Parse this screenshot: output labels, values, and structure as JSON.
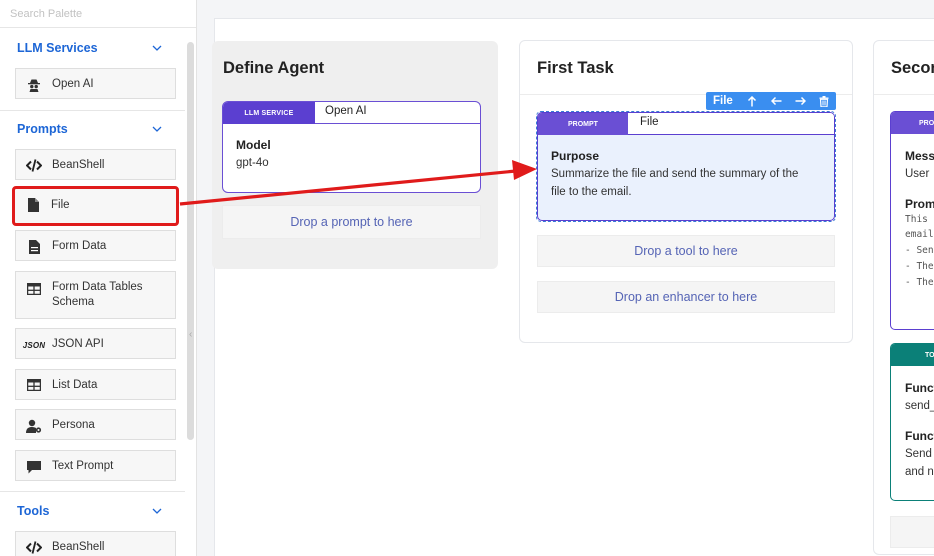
{
  "search": {
    "placeholder": "Search Palette"
  },
  "palette": {
    "llm_services": {
      "title": "LLM Services",
      "items": [
        {
          "label": "Open AI",
          "icon": "spy-icon"
        }
      ]
    },
    "prompts": {
      "title": "Prompts",
      "items": [
        {
          "label": "BeanShell",
          "icon": "code-icon"
        },
        {
          "label": "File",
          "icon": "file-icon"
        },
        {
          "label": "Form Data",
          "icon": "file-text-icon"
        },
        {
          "label": "Form Data Tables Schema",
          "icon": "table-icon"
        },
        {
          "label": "JSON API",
          "icon": "json-icon",
          "icon_text": "JSON"
        },
        {
          "label": "List Data",
          "icon": "table-icon"
        },
        {
          "label": "Persona",
          "icon": "user-gear-icon"
        },
        {
          "label": "Text Prompt",
          "icon": "speech-bubble-icon"
        }
      ]
    },
    "tools": {
      "title": "Tools",
      "items": [
        {
          "label": "BeanShell",
          "icon": "code-icon"
        }
      ]
    }
  },
  "define_agent": {
    "title": "Define Agent",
    "llm": {
      "tag": "LLM SERVICE",
      "name": "Open AI",
      "model_label": "Model",
      "model_value": "gpt-4o"
    },
    "drop_prompt": "Drop a prompt to here"
  },
  "first_task": {
    "title": "First Task",
    "toolbar": {
      "label": "File"
    },
    "prompt": {
      "tag": "PROMPT",
      "name": "File",
      "purpose_label": "Purpose",
      "purpose_line1": "Summarize the file and send the summary of the",
      "purpose_line2": "file to the email."
    },
    "drop_tool": "Drop a tool to here",
    "drop_enhancer": "Drop an enhancer to here"
  },
  "second_task": {
    "title": "Secon",
    "message_box": {
      "tag": "PRO",
      "label1": "Mess",
      "value1": "User",
      "label2": "Prom",
      "code_lines": [
        "This",
        "email",
        "- Sen",
        "- The",
        "- The"
      ]
    },
    "tool_box": {
      "tag": "TO",
      "label1": "Funct",
      "value1": "send_",
      "label2": "Funct",
      "value2_line1": "Send",
      "value2_line2": "and n"
    }
  },
  "colors": {
    "accent_blue": "#1d66d6",
    "llm_purple": "#5b3fd0",
    "prompt_purple": "#6a4fd4",
    "tool_teal": "#0b8078",
    "toolbar_blue": "#3a8ef0",
    "highlight_red": "#e01b1b"
  }
}
